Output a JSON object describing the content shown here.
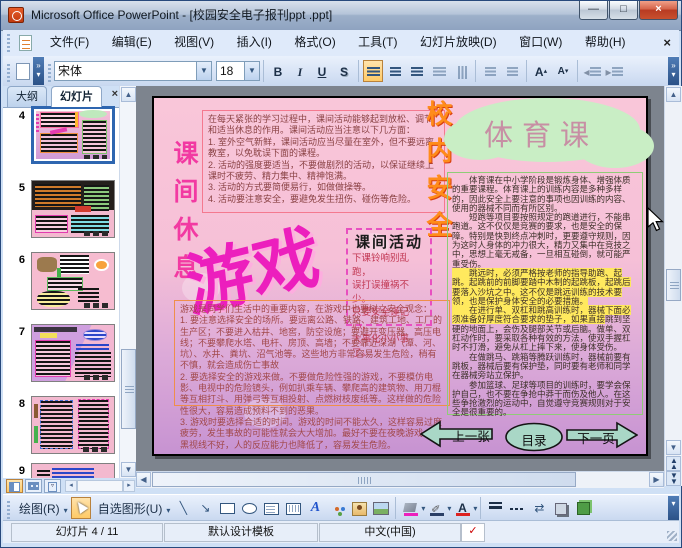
{
  "window": {
    "title": "Microsoft Office PowerPoint - [校园安全电子报刊ppt .ppt]",
    "controls": {
      "minimize": "—",
      "restore": "□",
      "close": "×"
    }
  },
  "menu_bar": {
    "items": [
      {
        "label": "文件(F)"
      },
      {
        "label": "编辑(E)"
      },
      {
        "label": "视图(V)"
      },
      {
        "label": "插入(I)"
      },
      {
        "label": "格式(O)"
      },
      {
        "label": "工具(T)"
      },
      {
        "label": "幻灯片放映(D)"
      },
      {
        "label": "窗口(W)"
      },
      {
        "label": "帮助(H)"
      }
    ],
    "close_label": "×"
  },
  "toolbar": {
    "font_name": "宋体",
    "font_size": "18",
    "bold": "B",
    "italic": "I",
    "underline": "U",
    "shadow": "S",
    "grow_font": "A",
    "shrink_font": "A",
    "overflow": "»"
  },
  "slides_panel": {
    "tabs": [
      {
        "label": "大纲"
      },
      {
        "label": "幻灯片"
      }
    ],
    "close_label": "×",
    "thumbnails": [
      {
        "number": "4"
      },
      {
        "number": "5"
      },
      {
        "number": "6"
      },
      {
        "number": "7"
      },
      {
        "number": "8"
      },
      {
        "number": "9"
      }
    ]
  },
  "slide": {
    "wordart": {
      "left_vertical": "课间休息",
      "right_vertical": "校内安全",
      "cloud_title": "体育课",
      "game": "游戏"
    },
    "break_box": {
      "text": "在每天紧张的学习过程中，课间活动能够起到放松、调节和适当休息的作用。课间活动应当注意以下几方面：\n1. 室外空气新鲜，课间活动应当尽量在室外，但不要远离教室，以免耽误下面的课程。\n2. 活动的强度要适当，不要做剧烈的活动，以保证继续上课时不疲劳、精力集中、精神饱满。\n3. 活动的方式要简便易行，如做做操等。\n4. 活动要注意安全，要避免发生扭伤、碰伤等危险。"
    },
    "activity_box": {
      "title": "课间活动",
      "lines": "下课铃响别乱跑，\n误打误撞祸不少。\n只要安全谨记心，\n大事化小小事了。"
    },
    "game_box": {
      "text": "游戏是同学们生活中的重要内容，在游戏中也要树立安全观念：\n1. 要注意选择安全的场所。要远离公路、铁路、建筑工地、工厂的生产区；不要进入枯井、地窖，防空设施；要避开变压器、高压电线；不要攀爬水塔、电杆、房顶、高墙；不要靠近深湖（潭、河、坑）、水井、粪坑、沼气池等。这些地方非常容易发生危险，稍有不慎，就会造成伤亡事故\n2. 要选择安全的游戏来做。不要做危险性强的游戏，不要模仿电影、电视中的危险镜头，例如扒乘车辆、攀爬高的建筑物、用刀棍等互相打斗、用弹弓等互相投射、点燃树枝废纸等。这样做的危险性很大，容易造成预料不到的恶果。\n3. 游戏时要选择合适的时间。游戏的时间不能太久，这样容易过度疲劳，发生事故的可能性就会大大增加。最好不要在夜晚游戏，天黑视线不好，人的反应能力也降低了，容易发生危险。"
    },
    "pe_box": {
      "part1": "　　体育课在中小学阶段是锻炼身体、增强体质的重要课程。体育课上的训练内容是多种多样的，因此安全上要注意的事项也因训练的内容、使用的器械不同而有所区别。\n　　短跑等项目要按照规定的跑道进行，不能串跑道。这不仅仅是竞赛的要求，也是安全的保障。特别是快到终点冲刺时，更要遵守规则，因为这时人身体的冲力很大，精力又集中在竞技之中，思想上毫无戒备，一旦相互碰倒，就可能严重受伤。\n",
      "highlight": "　　跳远时，必须严格按老师的指导助跑、起跳。起跳前的前脚要踏中木制的起跳板，起跳后要落入沙坑之中。这不仅是跳远训练的技术要领，也是保护身体安全的必要措施。\n　　在进行单、双杠和跳高训练时，器械下面必须准备好厚度符合要求的垫子，如果直接",
      "part2": "跳到坚硬的地面上，会伤及腿部关节或后脑。做单、双杠动作时，要采取各种有效的方法，使双手握杠时不打滑，避免从杠上摔下来，使身体受伤。\n　　在做跳马、跳箱等腾跃训练时，器械前要有跳板，器械后要有保护垫，同时要有老师和同学在器械旁站立保护。\n　　参加篮球、足球等项目的训练时，要学会保护自己，也不要在争抢中莽干而伤及他人。在这些争抢激烈的运动中，自觉遵守竞赛规则对于安全是很重要的。"
    },
    "nav": {
      "prev": "上一张",
      "menu": "目录",
      "next": "下一页"
    }
  },
  "drawing_toolbar": {
    "draw_label": "绘图(R)",
    "autoshapes_label": "自选图形(U)",
    "wordart_glyph": "A",
    "font_color_glyph": "A"
  },
  "status_bar": {
    "slide_indicator": "幻灯片 4 / 11",
    "design_template": "默认设计模板",
    "language": "中文(中国)"
  },
  "colors": {
    "slide_top_pink": "#f9c6d9",
    "slide_bottom_purple": "#c793d2",
    "wordart_magenta": "#ec1fbd",
    "wordart_orange": "#ff8c1a",
    "highlight_yellow": "#ffe95e",
    "nav_shape_fill": "#a9d7c6",
    "active_button_orange": "#ffca66"
  }
}
